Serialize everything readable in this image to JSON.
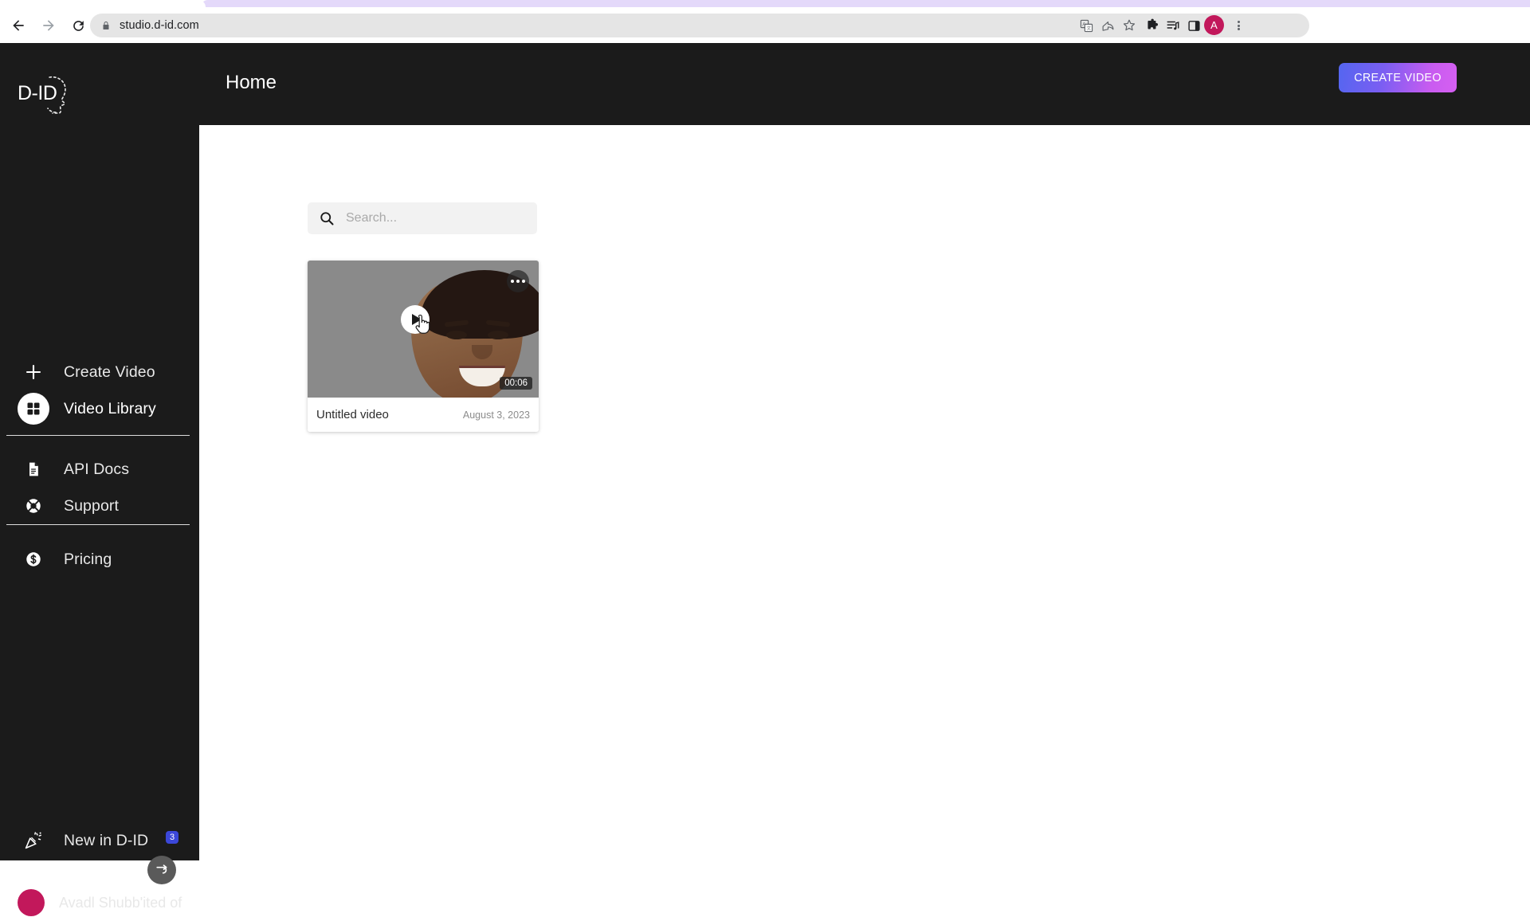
{
  "browser": {
    "url": "studio.d-id.com",
    "back_icon": "back-arrow-icon",
    "forward_icon": "forward-arrow-icon",
    "reload_icon": "reload-icon",
    "lock_icon": "lock-icon",
    "translate_icon": "translate-icon",
    "share_icon": "share-icon",
    "bookmark_icon": "star-icon",
    "extensions_icon": "puzzle-piece-icon",
    "media_icon": "media-playlist-icon",
    "sidepanel_icon": "side-panel-icon",
    "profile_initial": "A",
    "menu_icon": "three-dot-menu-icon"
  },
  "app": {
    "logo_text": "D-ID",
    "page_title": "Home",
    "create_video_button": "CREATE VIDEO",
    "accent_gradient_from": "#5466f0",
    "accent_gradient_to": "#d65ff2"
  },
  "sidebar": {
    "primary_items": [
      {
        "label": "Create Video",
        "icon": "plus-icon",
        "active": false
      },
      {
        "label": "Video Library",
        "icon": "grid-squares-icon",
        "active": true
      }
    ],
    "secondary_items": [
      {
        "label": "API Docs",
        "icon": "document-icon"
      },
      {
        "label": "Support",
        "icon": "lifebuoy-icon"
      }
    ],
    "tertiary_items": [
      {
        "label": "Pricing",
        "icon": "dollar-circle-icon"
      }
    ],
    "new_in_did": {
      "label": "New in D-ID",
      "icon": "party-popper-icon",
      "badge_count": "3",
      "badge_color": "#3b47d8"
    },
    "collapse_button_icon": "collapse-arrow-icon",
    "user": {
      "name": "Avadl Shubb'ited of",
      "avatar_color": "#c2185b"
    }
  },
  "main": {
    "search": {
      "placeholder": "Search...",
      "value": "",
      "icon": "search-icon"
    },
    "videos": [
      {
        "title": "Untitled video",
        "date": "August 3, 2023",
        "duration": "00:06",
        "menu_icon": "kebab-menu-icon",
        "play_icon": "play-icon"
      }
    ]
  }
}
